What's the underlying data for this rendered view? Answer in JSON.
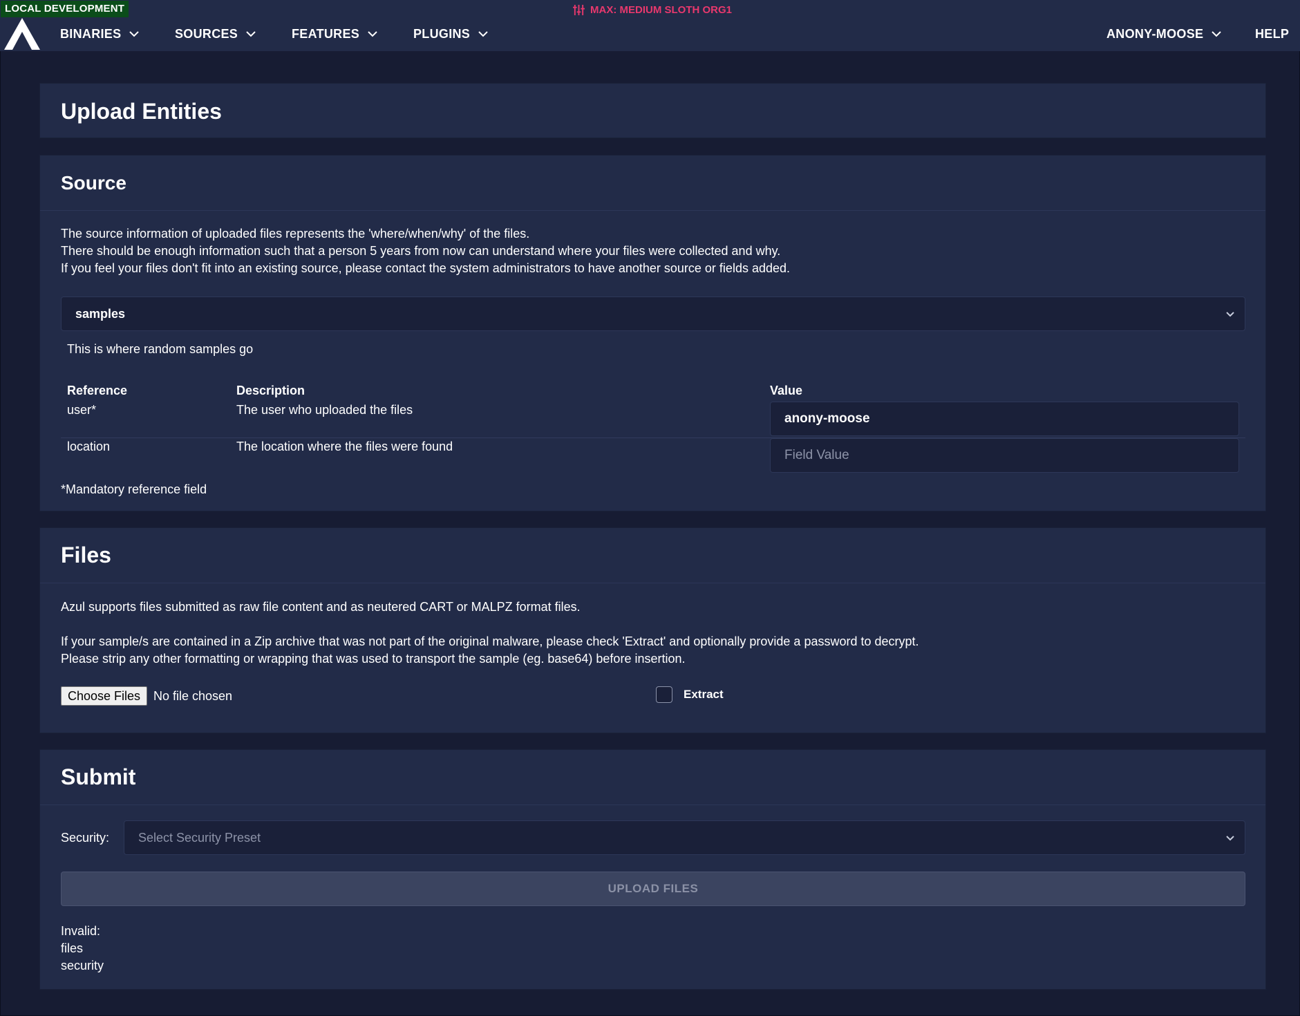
{
  "environment": {
    "label": "LOCAL DEVELOPMENT",
    "color": "#0b4d1a"
  },
  "classification": {
    "label": "MAX: MEDIUM SLOTH ORG1",
    "icon": "sliders-icon",
    "color": "#e8386d"
  },
  "nav": {
    "logo": "azul-logo",
    "items": [
      {
        "label": "BINARIES"
      },
      {
        "label": "SOURCES"
      },
      {
        "label": "FEATURES"
      },
      {
        "label": "PLUGINS"
      }
    ],
    "user": {
      "label": "ANONY-MOOSE"
    },
    "help": {
      "label": "HELP"
    }
  },
  "page": {
    "title": "Upload Entities"
  },
  "source": {
    "title": "Source",
    "intro": [
      "The source information of uploaded files represents the 'where/when/why' of the files.",
      "There should be enough information such that a person 5 years from now can understand where your files were collected and why.",
      "If you feel your files don't fit into an existing source, please contact the system administrators to have another source or fields added."
    ],
    "selected_source": "samples",
    "source_description": "This is where random samples go",
    "table": {
      "headers": {
        "reference": "Reference",
        "description": "Description",
        "value": "Value"
      },
      "rows": [
        {
          "reference": "user*",
          "description": "The user who uploaded the files",
          "value": "anony-moose",
          "placeholder": ""
        },
        {
          "reference": "location",
          "description": "The location where the files were found",
          "value": "",
          "placeholder": "Field Value"
        }
      ]
    },
    "footnote": "*Mandatory reference field"
  },
  "files": {
    "title": "Files",
    "paragraph1": "Azul supports files submitted as raw file content and as neutered CART or MALPZ format files.",
    "paragraph2": [
      "If your sample/s are contained in a Zip archive that was not part of the original malware, please check 'Extract' and optionally provide a password to decrypt.",
      "Please strip any other formatting or wrapping that was used to transport the sample (eg. base64) before insertion."
    ],
    "choose_label": "Choose Files",
    "no_file": "No file chosen",
    "extract_label": "Extract",
    "extract_checked": false
  },
  "submit": {
    "title": "Submit",
    "security_label": "Security:",
    "security_placeholder": "Select Security Preset",
    "upload_label": "UPLOAD FILES",
    "invalid_title": "Invalid:",
    "invalid_items": [
      "files",
      "security"
    ]
  }
}
